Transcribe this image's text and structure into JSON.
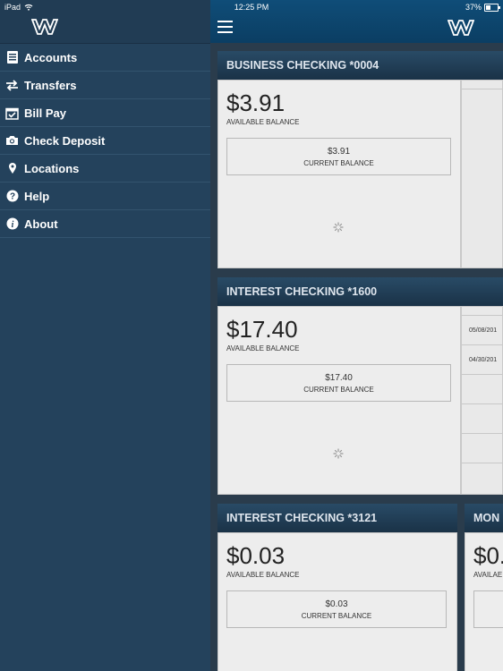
{
  "status_bar": {
    "device": "iPad",
    "time": "12:25 PM",
    "battery": "37%"
  },
  "colors": {
    "sidebar_bg": "#24425c",
    "topbar": "#0f4d78",
    "card_bg": "#ededed"
  },
  "sidebar": {
    "items": [
      {
        "label": "Accounts",
        "icon": "accounts-icon"
      },
      {
        "label": "Transfers",
        "icon": "transfers-icon"
      },
      {
        "label": "Bill Pay",
        "icon": "calendar-check-icon"
      },
      {
        "label": "Check Deposit",
        "icon": "camera-icon"
      },
      {
        "label": "Locations",
        "icon": "map-pin-icon"
      },
      {
        "label": "Help",
        "icon": "help-icon"
      },
      {
        "label": "About",
        "icon": "info-icon"
      }
    ]
  },
  "accounts": [
    {
      "name": "BUSINESS CHECKING *0004",
      "available": "$3.91",
      "available_label": "AVAILABLE BALANCE",
      "current": "$3.91",
      "current_label": "CURRENT BALANCE"
    },
    {
      "name": "INTEREST CHECKING *1600",
      "available": "$17.40",
      "available_label": "AVAILABLE BALANCE",
      "current": "$17.40",
      "current_label": "CURRENT BALANCE",
      "transactions": [
        "05/08/201",
        "04/30/201"
      ]
    },
    {
      "name": "INTEREST CHECKING *3121",
      "available": "$0.03",
      "available_label": "AVAILABLE BALANCE",
      "current": "$0.03",
      "current_label": "CURRENT BALANCE"
    },
    {
      "name": "MON",
      "available": "$0.",
      "available_label": "AVAILAE"
    }
  ]
}
